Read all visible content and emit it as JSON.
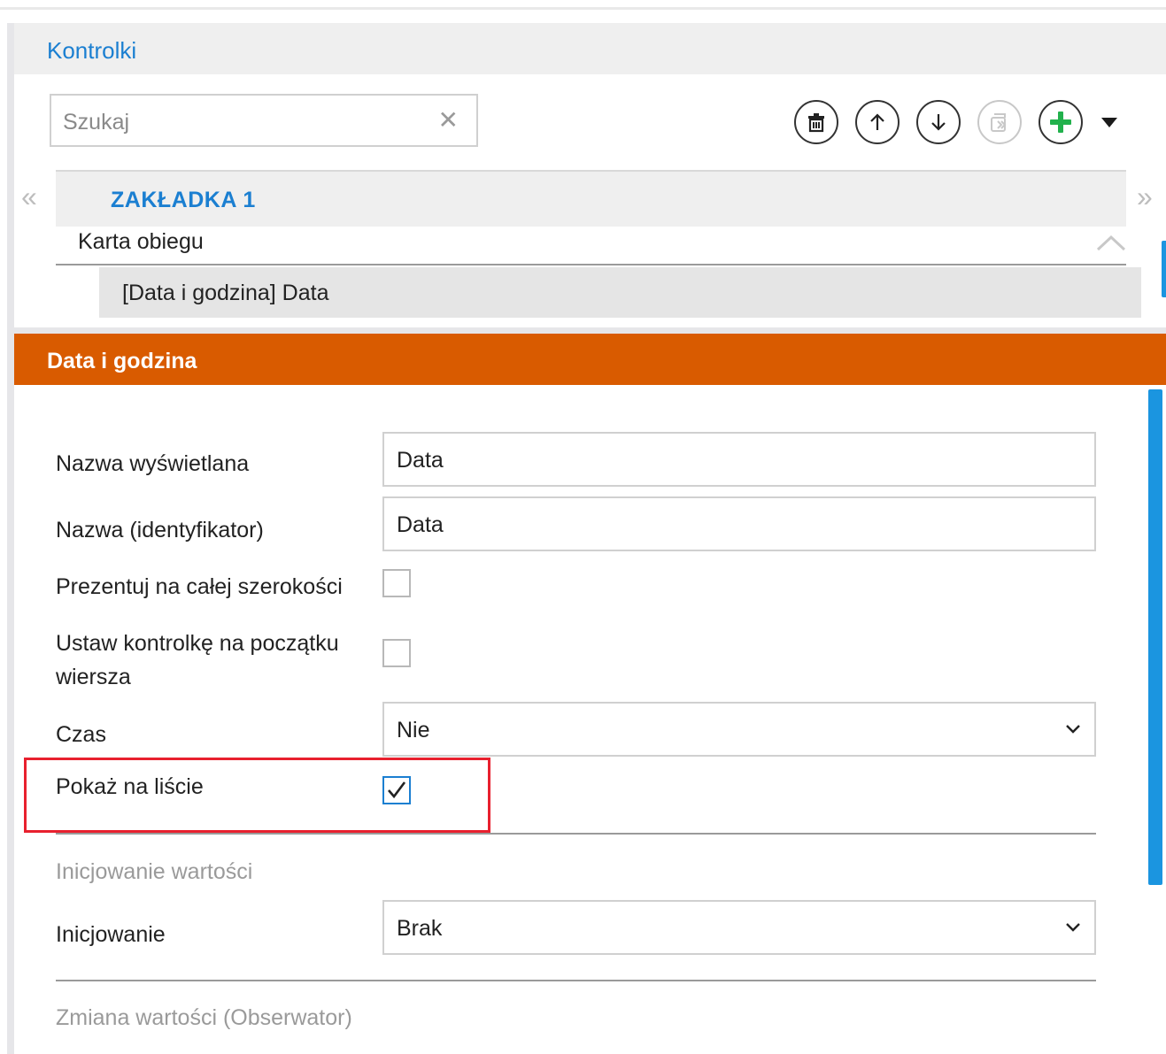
{
  "panel": {
    "title": "Kontrolki",
    "search": {
      "placeholder": "Szukaj",
      "clear_glyph": "✕"
    },
    "toolbar": {
      "icons": [
        "trash-icon",
        "arrow-up-icon",
        "arrow-down-icon",
        "copy-icon",
        "add-icon",
        "dropdown-arrow-icon"
      ]
    },
    "tab": {
      "label": "ZAKŁADKA 1",
      "prev_glyph": "«",
      "next_glyph": "»"
    },
    "section": {
      "label": "Karta obiegu"
    },
    "items": [
      {
        "label": "[Data i godzina] Data"
      }
    ]
  },
  "properties": {
    "title": "Data i godzina",
    "fields": {
      "display_name": {
        "label": "Nazwa wyświetlana",
        "value": "Data"
      },
      "identifier": {
        "label": "Nazwa (identyfikator)",
        "value": "Data"
      },
      "full_width": {
        "label": "Prezentuj na całej szerokości",
        "checked": false
      },
      "row_start": {
        "label_line1": "Ustaw kontrolkę na początku",
        "label_line2": "wiersza",
        "checked": false
      },
      "time": {
        "label": "Czas",
        "value": "Nie"
      },
      "show_on_list": {
        "label": "Pokaż na liście",
        "checked": true
      }
    },
    "init_section": {
      "heading": "Inicjowanie wartości",
      "init": {
        "label": "Inicjowanie",
        "value": "Brak"
      }
    },
    "observer_heading": "Zmiana wartości (Obserwator)"
  },
  "colors": {
    "accent_blue": "#1b7fd1",
    "header_orange": "#d95b00",
    "highlight_red": "#e8202e",
    "add_green": "#22b14c",
    "scrollbar_blue": "#1b95e0"
  }
}
